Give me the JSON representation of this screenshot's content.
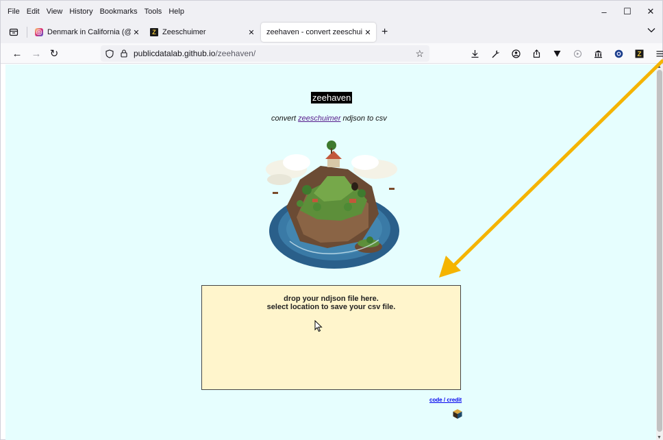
{
  "menubar": {
    "items": [
      "File",
      "Edit",
      "View",
      "History",
      "Bookmarks",
      "Tools",
      "Help"
    ]
  },
  "window_controls": {
    "minimize": "–",
    "maximize": "☐",
    "close": "✕"
  },
  "tabs": [
    {
      "title": "Denmark in California (@denm",
      "favicon": "instagram-icon",
      "active": false
    },
    {
      "title": "Zeeschuimer",
      "favicon": "zeeschuimer-icon",
      "active": false
    },
    {
      "title": "zeehaven - convert zeeschuimer nd",
      "favicon": "",
      "active": true
    }
  ],
  "tab_close": "✕",
  "newtab_label": "+",
  "nav": {
    "back": "←",
    "forward": "→",
    "reload": "↻",
    "url_host": "publicdatalab.github.io",
    "url_path": "/zeehaven/",
    "bookmark_star": "☆"
  },
  "toolbar_icons": [
    "download-icon",
    "wrench-icon",
    "account-icon",
    "share-icon",
    "pocket-icon",
    "extension-icon",
    "library-icon",
    "zeeschuimer-ext-icon",
    "zotero-icon",
    "menu-icon"
  ],
  "page": {
    "title": "zeehaven",
    "subtitle_prefix": "convert ",
    "subtitle_link": "zeeschuimer",
    "subtitle_suffix": " ndjson to csv",
    "dropzone_line1": "drop your ndjson file here.",
    "dropzone_line2": "select location to save your csv file.",
    "credit_link": "code / credit"
  },
  "colors": {
    "page_bg": "#e6fefe",
    "dropzone_bg": "#fff5cc",
    "annotation_arrow": "#f5b400"
  }
}
